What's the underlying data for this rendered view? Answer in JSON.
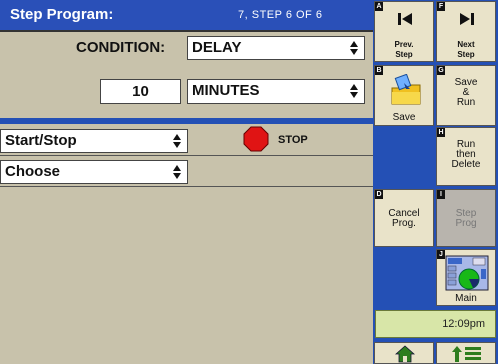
{
  "header": {
    "title": "Step Program:",
    "step_info": "7, STEP 6 OF 6"
  },
  "condition": {
    "label": "CONDITION:",
    "type_value": "DELAY",
    "amount": "10",
    "unit_value": "MINUTES"
  },
  "actions": {
    "action1_value": "Start/Stop",
    "action2_value": "Choose",
    "stop_label": "STOP"
  },
  "buttons": {
    "prev_key": "A",
    "prev_label": "Prev.\nStep",
    "next_key": "F",
    "next_label": "Next\nStep",
    "save_key": "B",
    "save_label": "Save",
    "save_run_key": "G",
    "save_run_label": "Save\n&\nRun",
    "run_delete_key": "H",
    "run_delete_label": "Run\nthen\nDelete",
    "cancel_key": "D",
    "cancel_label": "Cancel\nProg.",
    "step_prog_key": "I",
    "step_prog_label": "Step\nProg",
    "main_key": "J",
    "main_label": "Main"
  },
  "status": {
    "time": "12:09pm"
  },
  "colors": {
    "panel_bg": "#c8c2ab",
    "header_bg": "#2a50b8",
    "button_bg": "#e9e3c9",
    "stop_red": "#e01414",
    "clock_bg": "#d8e6a8"
  },
  "icons": {
    "prev": "skip-back-icon",
    "next": "skip-forward-icon",
    "save": "folder-save-icon",
    "main": "main-screen-icon",
    "home": "home-icon",
    "up": "up-arrow-list-icon"
  }
}
